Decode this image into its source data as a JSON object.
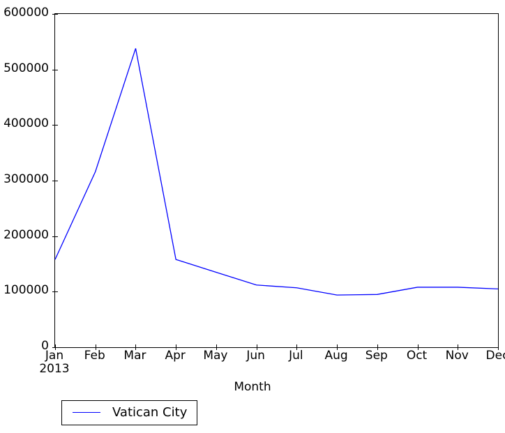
{
  "chart_data": {
    "type": "line",
    "title": "",
    "xlabel": "Month",
    "ylabel": "",
    "x": [
      "Jan",
      "Feb",
      "Mar",
      "Apr",
      "May",
      "Jun",
      "Jul",
      "Aug",
      "Sep",
      "Oct",
      "Nov",
      "Dec"
    ],
    "x_sub_labels": [
      "2013",
      "",
      "",
      "",
      "",
      "",
      "",
      "",
      "",
      "",
      "",
      ""
    ],
    "categories": [
      "Jan",
      "Feb",
      "Mar",
      "Apr",
      "May",
      "Jun",
      "Jul",
      "Aug",
      "Sep",
      "Oct",
      "Nov",
      "Dec"
    ],
    "series": [
      {
        "name": "Vatican City",
        "color": "#0000ff",
        "values": [
          158000,
          316000,
          538000,
          158000,
          135000,
          112000,
          107000,
          94000,
          95000,
          108000,
          108000,
          105000
        ]
      }
    ],
    "ylim": [
      0,
      600000
    ],
    "yticks": [
      0,
      100000,
      200000,
      300000,
      400000,
      500000,
      600000
    ],
    "ytick_labels": [
      "0",
      "100000",
      "200000",
      "300000",
      "400000",
      "500000",
      "600000"
    ],
    "xtick_labels": [
      "Jan",
      "Feb",
      "Mar",
      "Apr",
      "May",
      "Jun",
      "Jul",
      "Aug",
      "Sep",
      "Oct",
      "Nov",
      "Dec"
    ],
    "grid": false,
    "legend_position": "below-axes",
    "legend_entries": [
      "Vatican City"
    ]
  },
  "axis": {
    "xlabel": "Month",
    "year_label": "2013"
  },
  "legend": {
    "entry_label": "Vatican City",
    "line_color": "#0000ff"
  }
}
